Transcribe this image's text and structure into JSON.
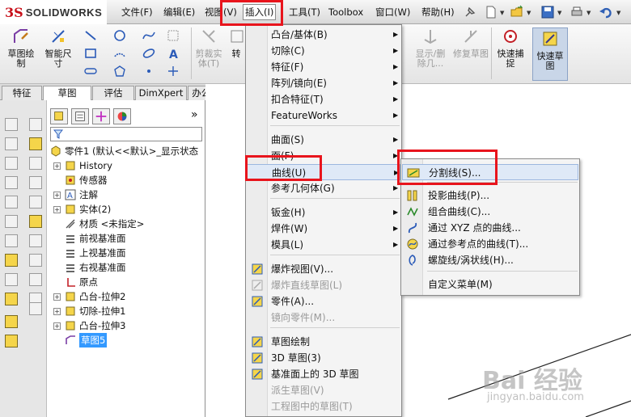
{
  "app": {
    "logo_ds": "3S",
    "logo_name": "SOLIDWORKS"
  },
  "menubar": {
    "items": [
      {
        "label": "文件(F)"
      },
      {
        "label": "编辑(E)"
      },
      {
        "label": "视图(V)"
      },
      {
        "label": "插入(I)",
        "active": true
      },
      {
        "label": "工具(T)"
      },
      {
        "label": "Toolbox"
      },
      {
        "label": "窗口(W)"
      },
      {
        "label": "帮助(H)"
      }
    ]
  },
  "command_manager": {
    "tools": [
      {
        "label": "草图绘制",
        "icon": "sketch-icon"
      },
      {
        "label": "智能尺寸",
        "icon": "smart-dimension-icon"
      },
      {
        "label": "剪裁实体(T)",
        "icon": "trim-entities-icon",
        "disabled": true
      },
      {
        "label": "转",
        "icon": "convert-icon"
      },
      {
        "label": "显示/删除几...",
        "icon": "display-delete-relations-icon",
        "disabled": true
      },
      {
        "label": "修复草图",
        "icon": "repair-sketch-icon",
        "disabled": true
      },
      {
        "label": "快速捕捉",
        "icon": "quick-snaps-icon"
      },
      {
        "label": "快速草图",
        "icon": "rapid-sketch-icon"
      }
    ]
  },
  "tabs": [
    {
      "label": "特征"
    },
    {
      "label": "草图",
      "selected": true
    },
    {
      "label": "评估"
    },
    {
      "label": "DimXpert"
    },
    {
      "label": "办公室产品"
    }
  ],
  "feature_tree": {
    "root": "零件1 (默认<<默认>_显示状态",
    "items": [
      {
        "label": "History",
        "expandable": true,
        "icon": "history-icon"
      },
      {
        "label": "传感器",
        "expandable": false,
        "icon": "sensor-icon"
      },
      {
        "label": "注解",
        "expandable": true,
        "icon": "annotations-icon"
      },
      {
        "label": "实体(2)",
        "expandable": true,
        "icon": "solid-bodies-icon"
      },
      {
        "label": "材质 <未指定>",
        "expandable": false,
        "icon": "material-icon"
      },
      {
        "label": "前视基准面",
        "expandable": false,
        "icon": "plane-icon"
      },
      {
        "label": "上视基准面",
        "expandable": false,
        "icon": "plane-icon"
      },
      {
        "label": "右视基准面",
        "expandable": false,
        "icon": "plane-icon"
      },
      {
        "label": "原点",
        "expandable": false,
        "icon": "origin-icon"
      },
      {
        "label": "凸台-拉伸2",
        "expandable": true,
        "icon": "boss-extrude-icon"
      },
      {
        "label": "切除-拉伸1",
        "expandable": true,
        "icon": "cut-extrude-icon"
      },
      {
        "label": "凸台-拉伸3",
        "expandable": true,
        "icon": "boss-extrude-icon"
      },
      {
        "label": "草图5",
        "expandable": false,
        "icon": "sketch-icon",
        "selected": true
      }
    ]
  },
  "insert_menu": {
    "items": [
      {
        "label": "凸台/基体(B)",
        "submenu": true
      },
      {
        "label": "切除(C)",
        "submenu": true
      },
      {
        "label": "特征(F)",
        "submenu": true
      },
      {
        "label": "阵列/镜向(E)",
        "submenu": true
      },
      {
        "label": "扣合特征(T)",
        "submenu": true
      },
      {
        "label": "FeatureWorks",
        "submenu": true
      },
      {
        "label": "曲面(S)",
        "submenu": true
      },
      {
        "label": "面(F)",
        "submenu": true
      },
      {
        "label": "曲线(U)",
        "submenu": true,
        "highlighted": true
      },
      {
        "label": "参考几何体(G)",
        "submenu": true
      },
      {
        "label": "钣金(H)",
        "submenu": true
      },
      {
        "label": "焊件(W)",
        "submenu": true
      },
      {
        "label": "模具(L)",
        "submenu": true
      },
      {
        "label": "爆炸视图(V)...",
        "icon": "exploded-view-icon"
      },
      {
        "label": "爆炸直线草图(L)",
        "icon": "explode-line-sketch-icon",
        "disabled": true
      },
      {
        "label": "零件(A)...",
        "icon": "part-icon"
      },
      {
        "label": "镜向零件(M)...",
        "disabled": true
      },
      {
        "label": "草图绘制",
        "icon": "sketch-icon"
      },
      {
        "label": "3D 草图(3)",
        "icon": "3d-sketch-icon"
      },
      {
        "label": "基准面上的 3D 草图",
        "icon": "3d-sketch-on-plane-icon"
      },
      {
        "label": "派生草图(V)",
        "disabled": true
      },
      {
        "label": "工程图中的草图(T)",
        "disabled": true
      }
    ]
  },
  "curve_menu": {
    "items": [
      {
        "label": "分割线(S)...",
        "icon": "split-line-icon",
        "highlighted": true
      },
      {
        "label": "投影曲线(P)...",
        "icon": "projected-curve-icon"
      },
      {
        "label": "组合曲线(C)...",
        "icon": "composite-curve-icon"
      },
      {
        "label": "通过 XYZ 点的曲线...",
        "icon": "curve-through-xyz-icon"
      },
      {
        "label": "通过参考点的曲线(T)...",
        "icon": "curve-through-ref-points-icon"
      },
      {
        "label": "螺旋线/涡状线(H)...",
        "icon": "helix-spiral-icon"
      },
      {
        "label": "自定义菜单(M)"
      }
    ]
  },
  "watermark": {
    "main": "Bai 经验",
    "sub": "jingyan.baidu.com"
  },
  "colors": {
    "annotation_red": "#e8141c",
    "selection_blue": "#3399ff",
    "menu_highlight": "#dfe9f7",
    "logo_red": "#c8101a"
  }
}
